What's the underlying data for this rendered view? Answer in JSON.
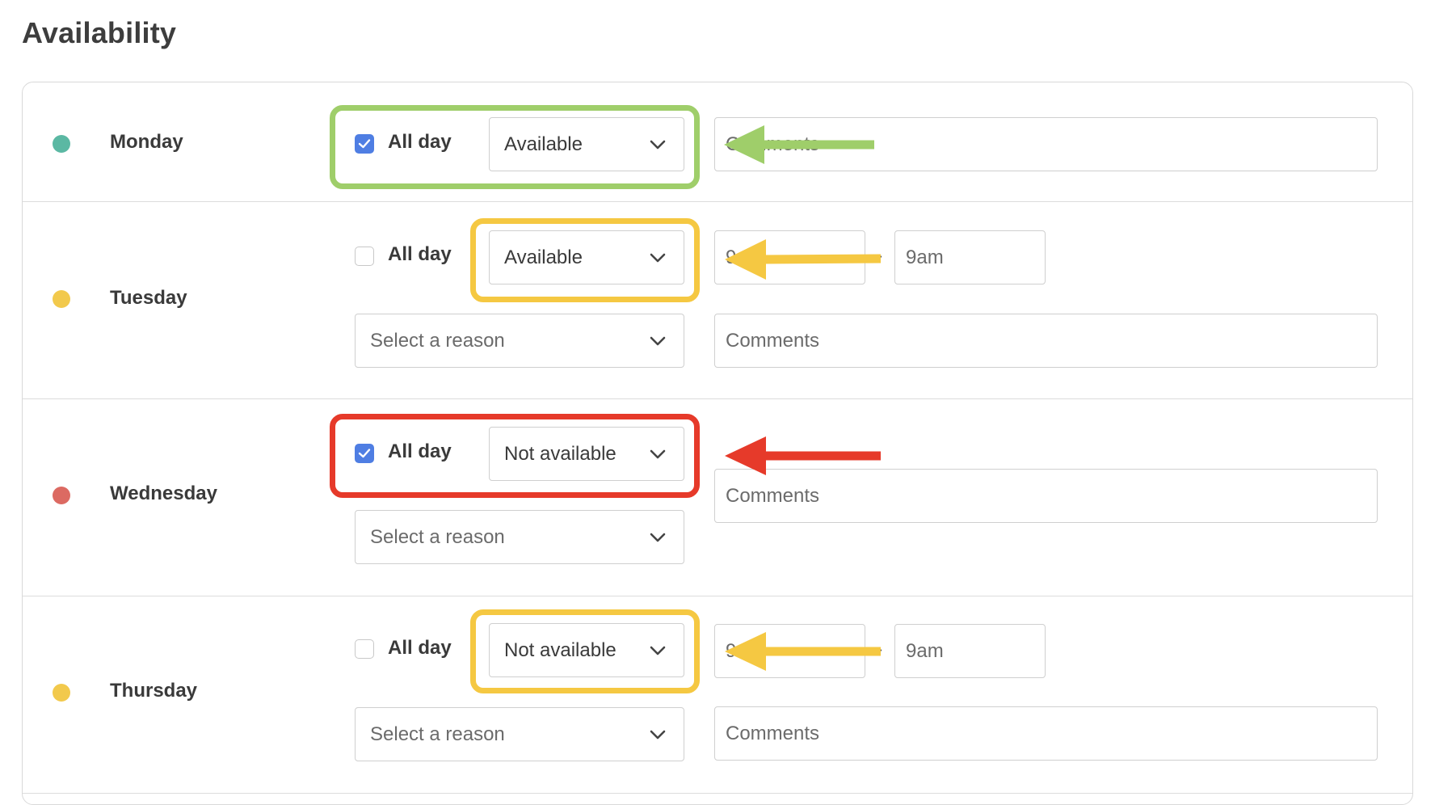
{
  "page": {
    "title": "Availability"
  },
  "colors": {
    "monday_dot": "#5bb8a3",
    "tuesday_dot": "#f2c94c",
    "wednesday_dot": "#dc6a62",
    "thursday_dot": "#f2c94c",
    "green_highlight": "#9fce6a",
    "yellow_highlight": "#f5c842",
    "red_highlight": "#e63a2a",
    "checkbox_checked": "#4f7ee3"
  },
  "rows": [
    {
      "day": "Monday",
      "all_day_label": "All day",
      "all_day_checked": true,
      "status": "Available",
      "comments_placeholder": "Comments"
    },
    {
      "day": "Tuesday",
      "all_day_label": "All day",
      "all_day_checked": false,
      "status": "Available",
      "start_time": "9",
      "end_time": "9am",
      "reason_placeholder": "Select a reason",
      "comments_placeholder": "Comments"
    },
    {
      "day": "Wednesday",
      "all_day_label": "All day",
      "all_day_checked": true,
      "status": "Not available",
      "reason_placeholder": "Select a reason",
      "comments_placeholder": "Comments"
    },
    {
      "day": "Thursday",
      "all_day_label": "All day",
      "all_day_checked": false,
      "status": "Not available",
      "start_time": "9",
      "end_time": "9am",
      "reason_placeholder": "Select a reason",
      "comments_placeholder": "Comments"
    }
  ],
  "icons": {
    "check": "check-icon",
    "chevron": "chevron-down-icon",
    "arrow": "arrow-left-icon"
  }
}
